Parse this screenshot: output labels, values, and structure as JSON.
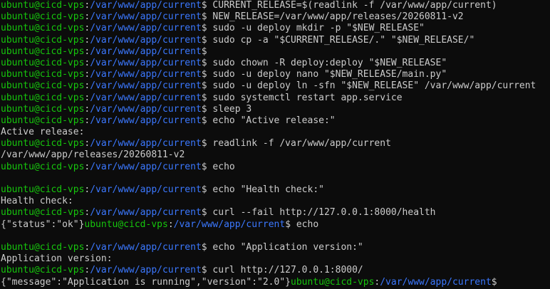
{
  "terminal": {
    "user_host": "ubuntu@cicd-vps",
    "cwd": "/var/www/app/current",
    "prompt_symbol": "$",
    "colors": {
      "background": "#0c0c0c",
      "foreground": "#cccccc",
      "user_host": "#16c60c",
      "path": "#3b78ff"
    },
    "lines": [
      {
        "type": "prompt",
        "cmd": " CURRENT_RELEASE=$(readlink -f /var/www/app/current)"
      },
      {
        "type": "prompt",
        "cmd": " NEW_RELEASE=/var/www/app/releases/20260811-v2"
      },
      {
        "type": "prompt",
        "cmd": " sudo -u deploy mkdir -p \"$NEW_RELEASE\""
      },
      {
        "type": "prompt",
        "cmd": " sudo cp -a \"$CURRENT_RELEASE/.\" \"$NEW_RELEASE/\""
      },
      {
        "type": "prompt",
        "cmd": ""
      },
      {
        "type": "prompt",
        "cmd": " sudo chown -R deploy:deploy \"$NEW_RELEASE\""
      },
      {
        "type": "prompt",
        "cmd": " sudo -u deploy nano \"$NEW_RELEASE/main.py\""
      },
      {
        "type": "prompt",
        "cmd": " sudo -u deploy ln -sfn \"$NEW_RELEASE\" /var/www/app/current"
      },
      {
        "type": "prompt",
        "cmd": " sudo systemctl restart app.service"
      },
      {
        "type": "prompt",
        "cmd": " sleep 3"
      },
      {
        "type": "prompt",
        "cmd": " echo \"Active release:\""
      },
      {
        "type": "output",
        "text": "Active release:"
      },
      {
        "type": "prompt",
        "cmd": " readlink -f /var/www/app/current"
      },
      {
        "type": "output",
        "text": "/var/www/app/releases/20260811-v2"
      },
      {
        "type": "prompt",
        "cmd": " echo"
      },
      {
        "type": "output",
        "text": ""
      },
      {
        "type": "prompt",
        "cmd": " echo \"Health check:\""
      },
      {
        "type": "output",
        "text": "Health check:"
      },
      {
        "type": "prompt",
        "cmd": " curl --fail http://127.0.0.1:8000/health"
      },
      {
        "type": "output_prompt",
        "text": "{\"status\":\"ok\"}",
        "cmd": " echo"
      },
      {
        "type": "output",
        "text": ""
      },
      {
        "type": "prompt",
        "cmd": " echo \"Application version:\""
      },
      {
        "type": "output",
        "text": "Application version:"
      },
      {
        "type": "prompt",
        "cmd": " curl http://127.0.0.1:8000/"
      },
      {
        "type": "output_prompt",
        "text": "{\"message\":\"Application is running\",\"version\":\"2.0\"}",
        "cmd": ""
      }
    ]
  }
}
